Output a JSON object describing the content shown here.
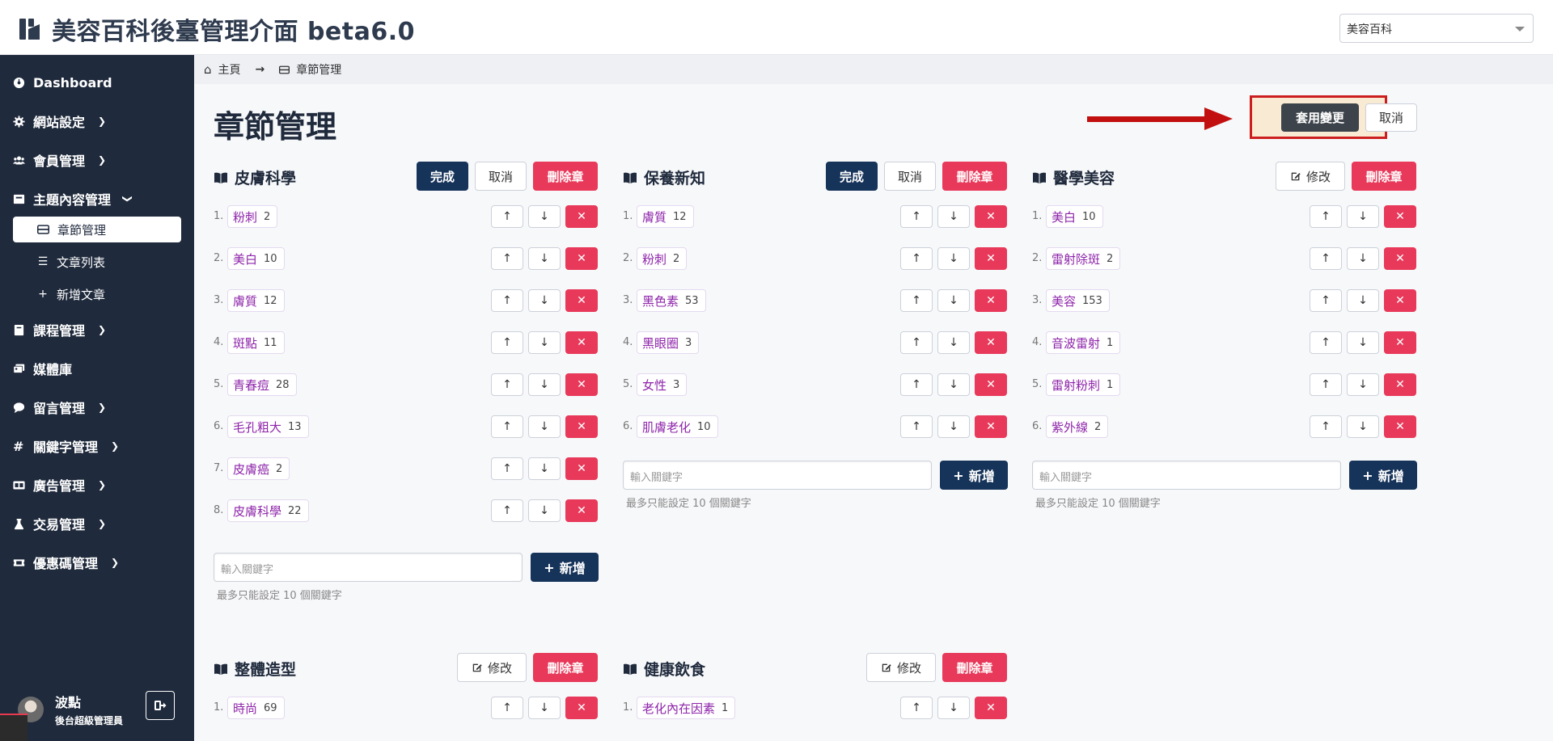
{
  "header": {
    "title": "美容百科後臺管理介面 beta6.0",
    "site_select": "美容百科"
  },
  "sidebar": {
    "items": [
      {
        "label": "Dashboard",
        "icon": "dashboard-icon"
      },
      {
        "label": "網站設定",
        "icon": "gear-icon"
      },
      {
        "label": "會員管理",
        "icon": "users-icon"
      },
      {
        "label": "主題內容管理",
        "icon": "archive-icon"
      },
      {
        "label": "課程管理",
        "icon": "book-icon"
      },
      {
        "label": "媒體庫",
        "icon": "images-icon"
      },
      {
        "label": "留言管理",
        "icon": "comment-icon"
      },
      {
        "label": "關鍵字管理",
        "icon": "hashtag-icon"
      },
      {
        "label": "廣告管理",
        "icon": "ad-icon"
      },
      {
        "label": "交易管理",
        "icon": "flask-icon"
      },
      {
        "label": "優惠碼管理",
        "icon": "ticket-icon"
      }
    ],
    "subitems": [
      {
        "label": "章節管理",
        "icon": "card-icon"
      },
      {
        "label": "文章列表",
        "icon": "list-icon"
      },
      {
        "label": "新增文章",
        "icon": "plus-icon"
      }
    ],
    "user": {
      "name": "波點",
      "role": "後台超級管理員"
    }
  },
  "breadcrumb": {
    "home": "主頁",
    "current": "章節管理"
  },
  "page": {
    "title": "章節管理",
    "apply_label": "套用變更",
    "cancel_label": "取消"
  },
  "labels": {
    "done": "完成",
    "cancel": "取消",
    "delete": "刪除章",
    "edit": "修改",
    "add": "新增",
    "placeholder": "輸入關鍵字",
    "hint": "最多只能設定 10 個關鍵字"
  },
  "sections": [
    {
      "title": "皮膚科學",
      "keywords": [
        {
          "num": "1.",
          "name": "粉刺",
          "count": "2"
        },
        {
          "num": "2.",
          "name": "美白",
          "count": "10"
        },
        {
          "num": "3.",
          "name": "膚質",
          "count": "12"
        },
        {
          "num": "4.",
          "name": "斑點",
          "count": "11"
        },
        {
          "num": "5.",
          "name": "青春痘",
          "count": "28"
        },
        {
          "num": "6.",
          "name": "毛孔粗大",
          "count": "13"
        },
        {
          "num": "7.",
          "name": "皮膚癌",
          "count": "2"
        },
        {
          "num": "8.",
          "name": "皮膚科學",
          "count": "22"
        }
      ]
    },
    {
      "title": "保養新知",
      "keywords": [
        {
          "num": "1.",
          "name": "膚質",
          "count": "12"
        },
        {
          "num": "2.",
          "name": "粉刺",
          "count": "2"
        },
        {
          "num": "3.",
          "name": "黑色素",
          "count": "53"
        },
        {
          "num": "4.",
          "name": "黑眼圈",
          "count": "3"
        },
        {
          "num": "5.",
          "name": "女性",
          "count": "3"
        },
        {
          "num": "6.",
          "name": "肌膚老化",
          "count": "10"
        }
      ]
    },
    {
      "title": "醫學美容",
      "keywords": [
        {
          "num": "1.",
          "name": "美白",
          "count": "10"
        },
        {
          "num": "2.",
          "name": "雷射除斑",
          "count": "2"
        },
        {
          "num": "3.",
          "name": "美容",
          "count": "153"
        },
        {
          "num": "4.",
          "name": "音波雷射",
          "count": "1"
        },
        {
          "num": "5.",
          "name": "雷射粉刺",
          "count": "1"
        },
        {
          "num": "6.",
          "name": "紫外線",
          "count": "2"
        }
      ]
    },
    {
      "title": "整體造型",
      "keywords": [
        {
          "num": "1.",
          "name": "時尚",
          "count": "69"
        }
      ]
    },
    {
      "title": "健康飲食",
      "keywords": [
        {
          "num": "1.",
          "name": "老化內在因素",
          "count": "1"
        }
      ]
    }
  ]
}
